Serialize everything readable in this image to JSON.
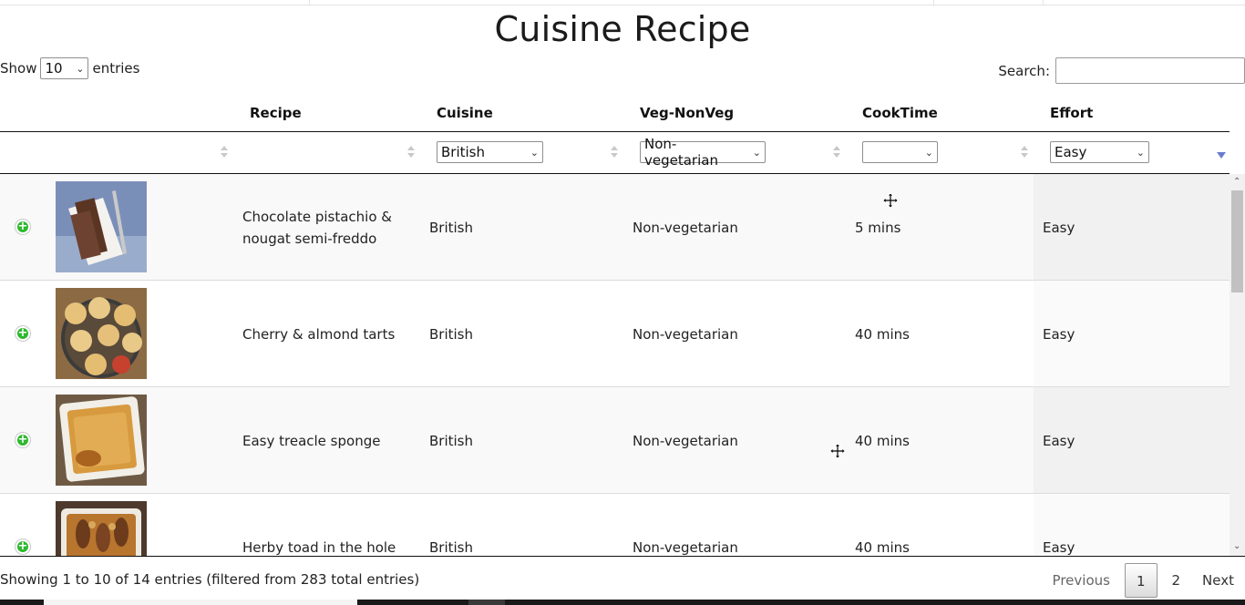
{
  "page": {
    "title": "Cuisine Recipe"
  },
  "length_menu": {
    "show_label": "Show",
    "value": "10",
    "entries_label": "entries"
  },
  "search": {
    "label": "Search:",
    "value": ""
  },
  "columns": {
    "recipe": "Recipe",
    "cuisine": "Cuisine",
    "veg": "Veg-NonVeg",
    "cooktime": "CookTime",
    "effort": "Effort"
  },
  "filters": {
    "cuisine": "British",
    "veg": "Non-vegetarian",
    "cooktime": "",
    "effort": "Easy"
  },
  "rows": [
    {
      "recipe": "Chocolate pistachio & nougat semi-freddo",
      "cuisine": "British",
      "veg": "Non-vegetarian",
      "cooktime": "5 mins",
      "effort": "Easy",
      "image": "chocolate-slice-image"
    },
    {
      "recipe": "Cherry & almond tarts",
      "cuisine": "British",
      "veg": "Non-vegetarian",
      "cooktime": "40 mins",
      "effort": "Easy",
      "image": "tarts-on-rack-image"
    },
    {
      "recipe": "Easy treacle sponge",
      "cuisine": "British",
      "veg": "Non-vegetarian",
      "cooktime": "40 mins",
      "effort": "Easy",
      "image": "sponge-in-dish-image"
    },
    {
      "recipe": "Herby toad in the hole",
      "cuisine": "British",
      "veg": "Non-vegetarian",
      "cooktime": "40 mins",
      "effort": "Easy",
      "image": "toad-in-hole-image"
    }
  ],
  "info": "Showing 1 to 10 of 14 entries (filtered from 283 total entries)",
  "pagination": {
    "previous": "Previous",
    "pages": [
      "1",
      "2"
    ],
    "current": "1",
    "next": "Next"
  },
  "colors": {
    "expand_green": "#2eb82e",
    "sort_caret_blue": "#6b7bd1",
    "header_rule": "#111111"
  }
}
